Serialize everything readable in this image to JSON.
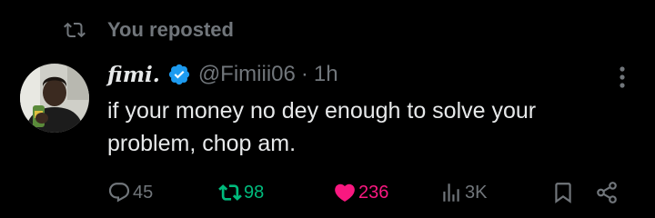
{
  "repost_header": {
    "text": "You reposted",
    "icon": "repost-icon"
  },
  "tweet": {
    "display_name": "fimi.",
    "verified": true,
    "handle": "@Fimiii06",
    "separator": "·",
    "time": "1h",
    "text": "if your money no dey enough to solve your problem, chop am.",
    "avatar": "profile-photo"
  },
  "actions": {
    "replies": "45",
    "reposts": "98",
    "likes": "236",
    "views": "3K",
    "reposted_by_user": true,
    "liked_by_user": true
  },
  "colors": {
    "background": "#000000",
    "text": "#e7e9ea",
    "muted": "#71767b",
    "repost_active": "#00ba7c",
    "like_active": "#f91880",
    "verified_badge": "#1d9bf0"
  }
}
